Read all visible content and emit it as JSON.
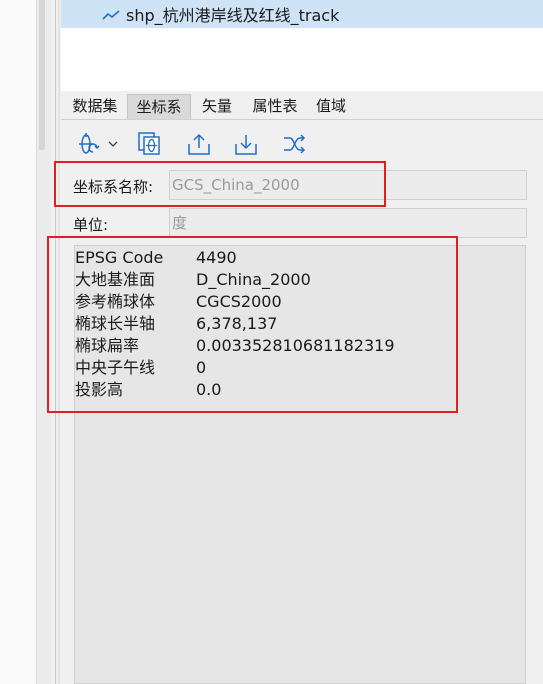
{
  "tree": {
    "selected_item": "shp_杭州港岸线及红线_track",
    "item_icon": "line-layer-icon"
  },
  "tabs": [
    {
      "label": "数据集"
    },
    {
      "label": "坐标系",
      "active": true
    },
    {
      "label": "矢量"
    },
    {
      "label": "属性表"
    },
    {
      "label": "值域"
    }
  ],
  "toolbar": {
    "icons": [
      "projection-settings-icon",
      "dropdown-arrow-icon",
      "copy-coordinate-system-icon",
      "export-icon",
      "import-icon",
      "convert-icon"
    ]
  },
  "form": {
    "crs_name_label": "坐标系名称:",
    "crs_name_value": "GCS_China_2000",
    "unit_label": "单位:",
    "unit_value": "度"
  },
  "info": [
    {
      "key": "EPSG Code",
      "value": "4490"
    },
    {
      "key": "大地基准面",
      "value": "D_China_2000"
    },
    {
      "key": "参考椭球体",
      "value": "CGCS2000"
    },
    {
      "key": "椭球长半轴",
      "value": "6,378,137"
    },
    {
      "key": "椭球扁率",
      "value": "0.003352810681182319"
    },
    {
      "key": "中央子午线",
      "value": "0"
    },
    {
      "key": "投影高",
      "value": "0.0"
    }
  ],
  "colors": {
    "annotation": "#e02020",
    "selection": "#cfe3f7",
    "icon_blue": "#1f6fc7"
  }
}
